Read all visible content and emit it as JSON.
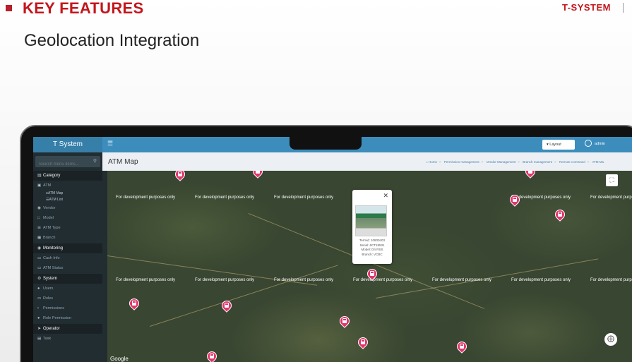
{
  "slide": {
    "key_features": "KEY FEATURES",
    "brand": "T-SYSTEM",
    "subtitle": "Geolocation Integration"
  },
  "app": {
    "logo": "T System",
    "search_placeholder": "Search menu items...",
    "sidebar": {
      "category": "Category",
      "atm": "ATM",
      "atm_map": "ATM Map",
      "atm_list": "ATM List",
      "vendor": "Vendor",
      "model": "Model",
      "atm_type": "ATM Type",
      "branch": "Branch",
      "monitoring": "Monitoring",
      "cash_info": "Cash Info",
      "atm_status": "ATM Status",
      "system": "System",
      "users": "Users",
      "roles": "Roles",
      "permissions": "Permissions",
      "role_permission": "Role Permission",
      "operator": "Operator",
      "task": "Task"
    },
    "topbar": {
      "layout": "Layout",
      "user": "admin"
    },
    "page_title": "ATM Map",
    "breadcrumb": [
      "Home",
      "Permission management",
      "Vendor Management",
      "Branch management",
      "Remote command",
      "ATM Ma"
    ],
    "map": {
      "watermark": "For development purposes only",
      "popup": {
        "terminal": "Termid: 10800403",
        "serial": "Serial: 6CT18531",
        "model": "Model: Dri RSS",
        "branch": "Branch: VCBC"
      },
      "google": "Google"
    }
  }
}
